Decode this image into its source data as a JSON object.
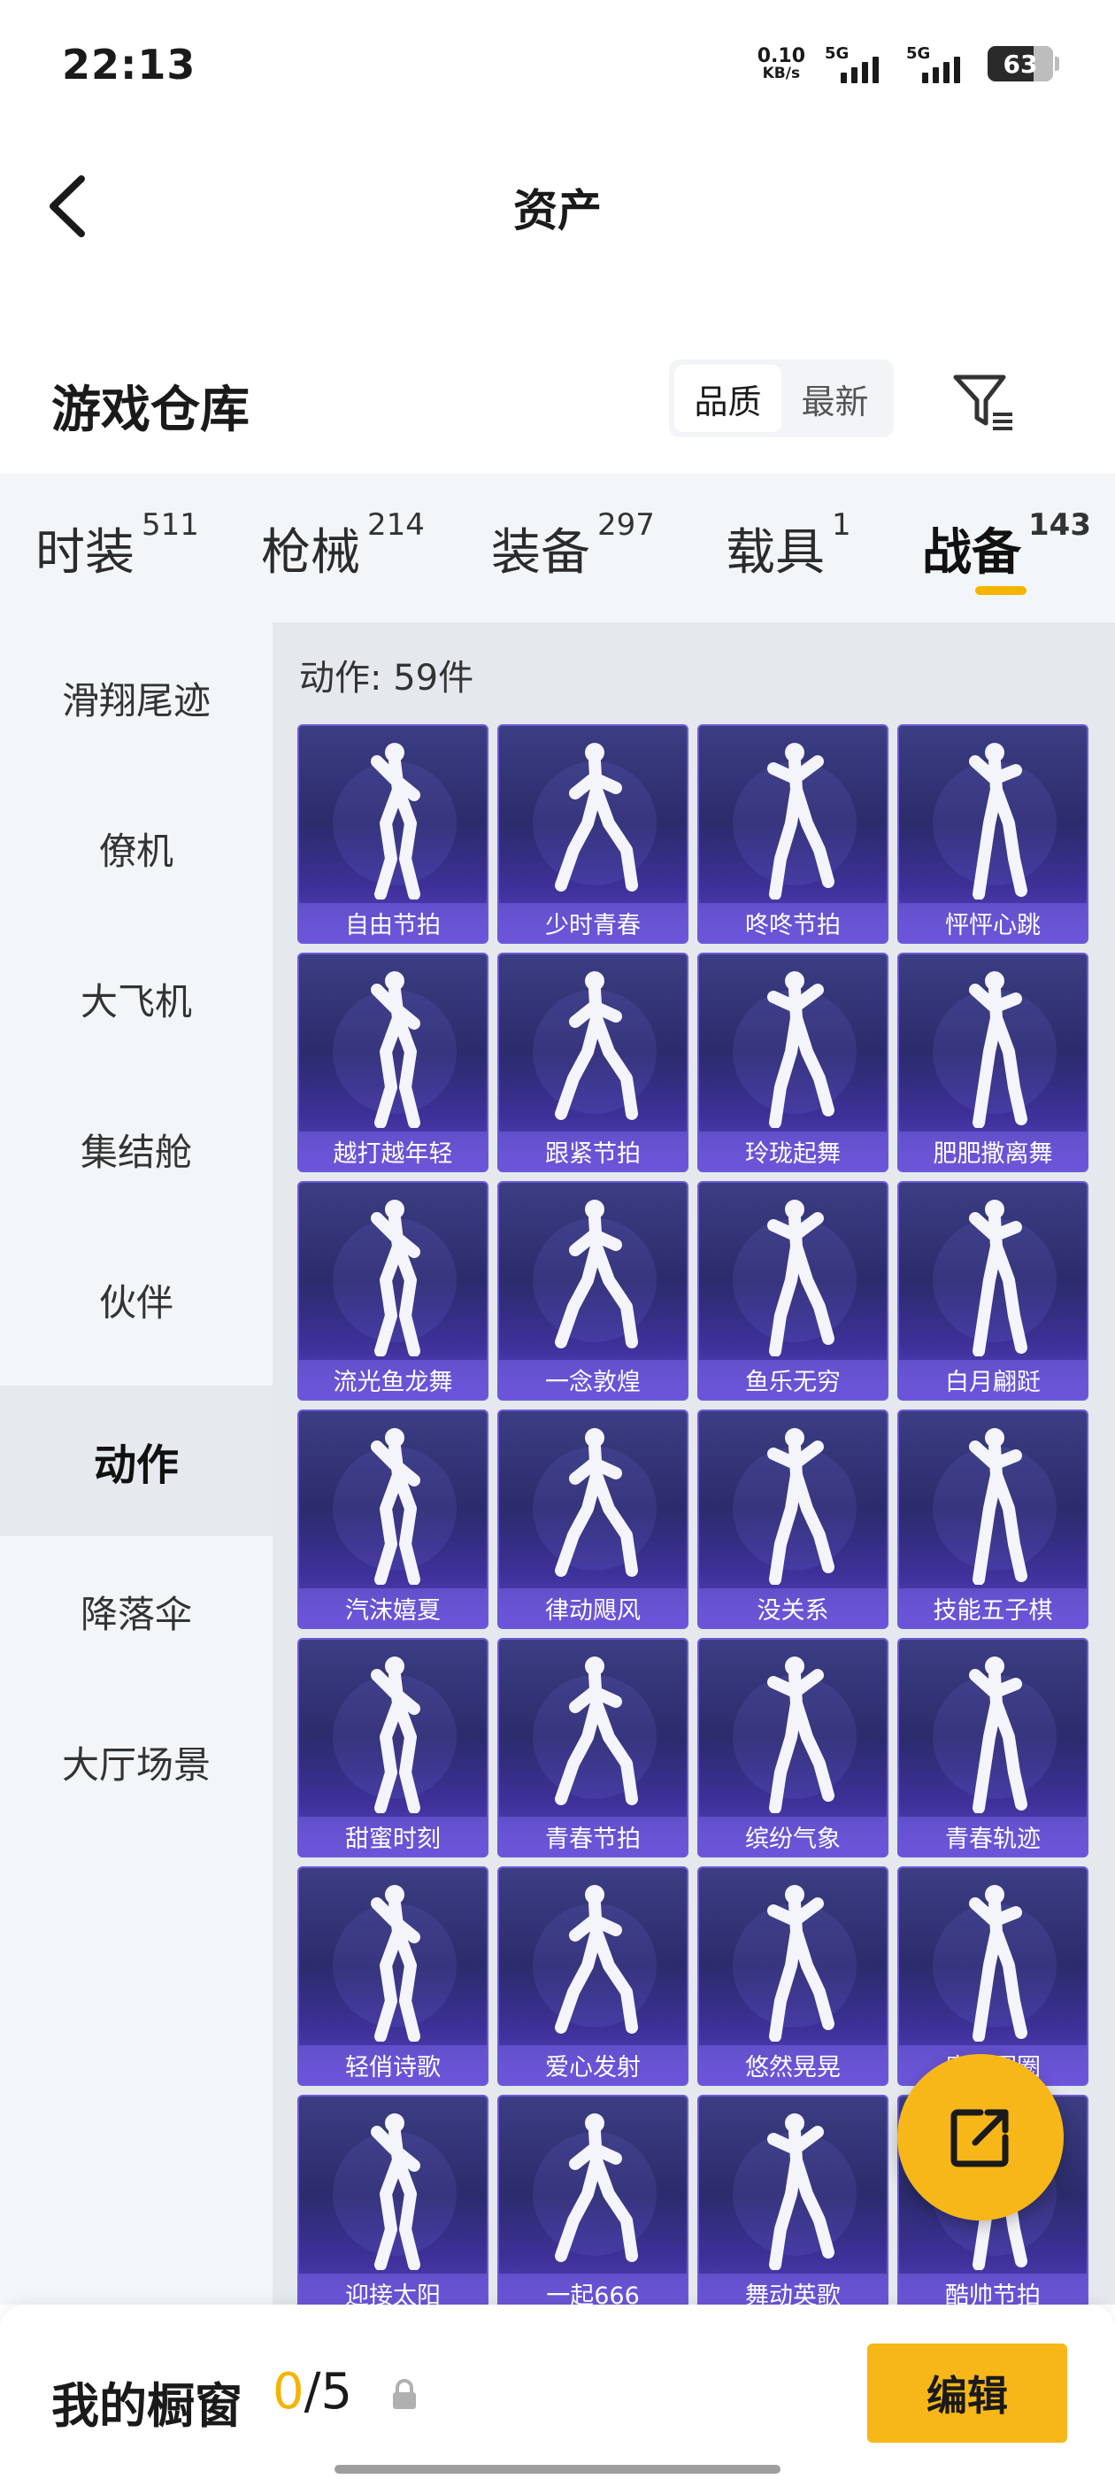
{
  "status_bar": {
    "time": "22:13",
    "net_speed_value": "0.10",
    "net_speed_unit": "KB/s",
    "sim1": "5G",
    "sim2": "5G",
    "battery": "63"
  },
  "header": {
    "title": "资产"
  },
  "section": {
    "title": "游戏仓库",
    "sort_options": [
      "品质",
      "最新"
    ],
    "sort_selected": "品质"
  },
  "tabs": [
    {
      "label": "时装",
      "count": "511"
    },
    {
      "label": "枪械",
      "count": "214"
    },
    {
      "label": "装备",
      "count": "297"
    },
    {
      "label": "载具",
      "count": "1"
    },
    {
      "label": "战备",
      "count": "143",
      "active": true
    }
  ],
  "sidebar": {
    "items": [
      "滑翔尾迹",
      "僚机",
      "大飞机",
      "集结舱",
      "伙伴",
      "动作",
      "降落伞",
      "大厅场景"
    ],
    "active": "动作"
  },
  "content": {
    "count_label": "动作: 59件",
    "items": [
      "自由节拍",
      "少时青春",
      "咚咚节拍",
      "怦怦心跳",
      "越打越年轻",
      "跟紧节拍",
      "玲珑起舞",
      "肥肥撒离舞",
      "流光鱼龙舞",
      "一念敦煌",
      "鱼乐无穷",
      "白月翩跹",
      "汽沫嬉夏",
      "律动飓风",
      "没关系",
      "技能五子棋",
      "甜蜜时刻",
      "青春节拍",
      "缤纷气象",
      "青春轨迹",
      "轻俏诗歌",
      "爱心发射",
      "悠然晃晃",
      "魔力圈圈",
      "迎接太阳",
      "一起666",
      "舞动英歌",
      "酷帅节拍"
    ]
  },
  "bottom_bar": {
    "showcase_label": "我的橱窗",
    "showcase_current": "0",
    "showcase_total": "/5",
    "edit_label": "编辑"
  },
  "icons": {
    "back": "chevron-left-icon",
    "filter": "filter-icon",
    "share": "share-icon",
    "lock": "lock-icon"
  },
  "colors": {
    "accent": "#f7b718",
    "card_bg": "#2c2b6c",
    "card_label": "#6e56dc"
  }
}
